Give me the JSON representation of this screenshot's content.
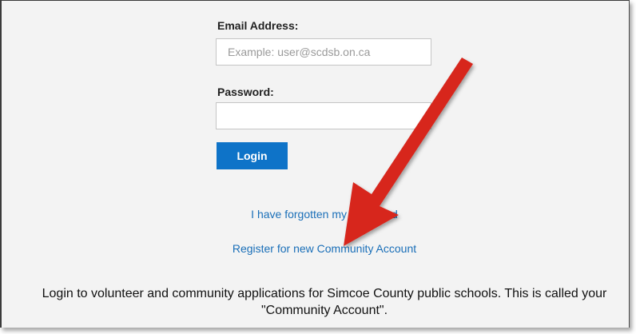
{
  "form": {
    "email_label": "Email Address:",
    "email_placeholder": "Example: user@scdsb.on.ca",
    "email_value": "",
    "password_label": "Password:",
    "password_value": "",
    "login_label": "Login"
  },
  "links": {
    "forgot_password": "I have forgotten my password",
    "register": "Register for new Community Account"
  },
  "description": "Login to volunteer and community applications for Simcoe County public schools. This is called your \"Community Account\".",
  "colors": {
    "accent": "#0e73c8",
    "link": "#1a6fb8",
    "annotation_arrow": "#d7261e",
    "background": "#f3f3f3"
  },
  "annotation": {
    "icon": "red-arrow-pointing-at-register-link"
  }
}
